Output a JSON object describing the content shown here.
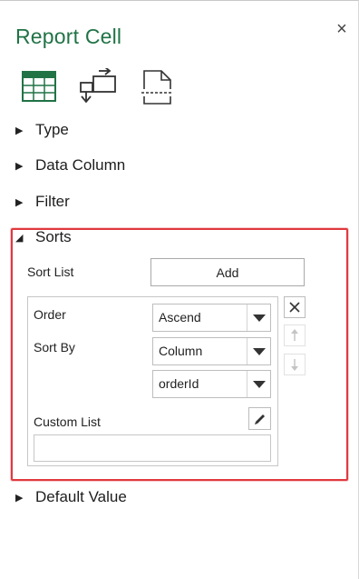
{
  "panel": {
    "title": "Report Cell",
    "close_glyph": "×",
    "toolbar_icons": [
      "table-grid-icon",
      "swap-rows-icon",
      "page-layout-icon"
    ],
    "accent_color": "#217346",
    "highlight_color": "#e0393e"
  },
  "sections": {
    "type": "Type",
    "data_column": "Data Column",
    "filter": "Filter",
    "sorts": "Sorts",
    "default_value": "Default Value"
  },
  "sorts": {
    "sort_list_label": "Sort List",
    "add_label": "Add",
    "order_label": "Order",
    "order_value": "Ascend",
    "sort_by_label": "Sort By",
    "sort_by_value": "Column",
    "column_value": "orderId",
    "custom_list_label": "Custom List",
    "custom_list_value": ""
  }
}
